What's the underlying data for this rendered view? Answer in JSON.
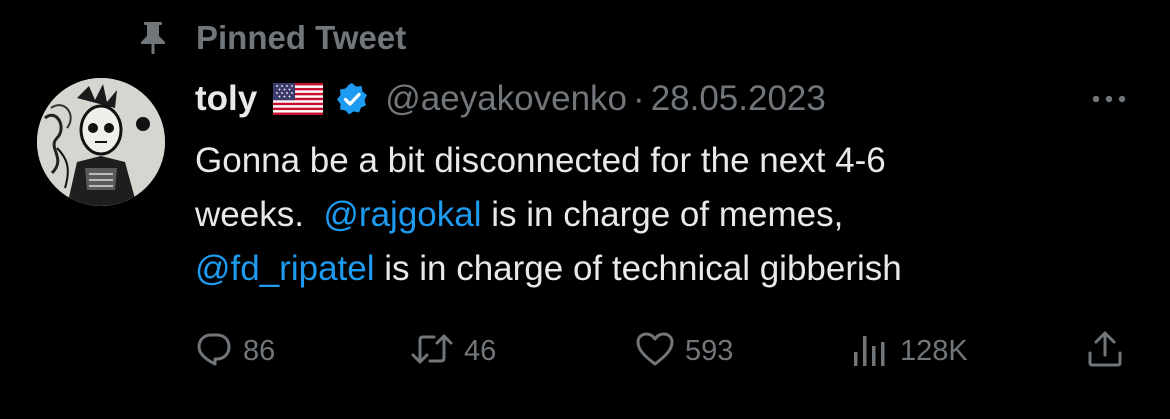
{
  "pinned": {
    "label": "Pinned Tweet",
    "icon": "pin-icon"
  },
  "author": {
    "display_name": "toly",
    "flag_icon": "us-flag-icon",
    "verified_icon": "verified-badge-icon",
    "handle": "@aeyakovenko",
    "separator": "·",
    "date": "28.05.2023"
  },
  "tweet": {
    "text_line1": "Gonna be a bit disconnected for the next 4-6",
    "text_line2_pre": "weeks.  ",
    "mention1": "@rajgokal",
    "text_line2_post": " is in charge of memes,",
    "mention2": "@fd_ripatel",
    "text_line3_post": " is in charge of technical gibberish"
  },
  "actions": {
    "reply_count": "86",
    "retweet_count": "46",
    "like_count": "593",
    "views_count": "128K"
  },
  "colors": {
    "background": "#000000",
    "text_primary": "#e7e9ea",
    "text_secondary": "#71767b",
    "link": "#1d9bf0",
    "verified": "#1d9bf0"
  }
}
